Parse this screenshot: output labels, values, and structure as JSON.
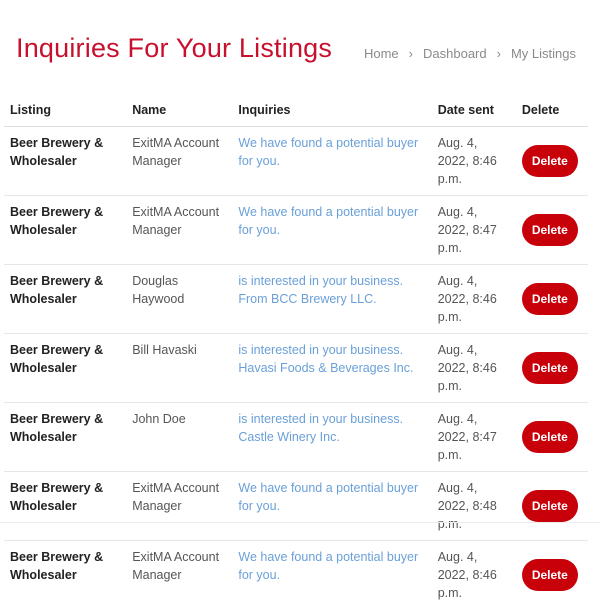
{
  "page": {
    "title": "Inquiries For Your Listings"
  },
  "breadcrumb": {
    "items": [
      "Home",
      "Dashboard",
      "My Listings"
    ],
    "separator": "›"
  },
  "table": {
    "headers": {
      "listing": "Listing",
      "name": "Name",
      "inquiries": "Inquiries",
      "date_sent": "Date sent",
      "delete": "Delete"
    },
    "delete_label": "Delete",
    "rows": [
      {
        "listing": "Beer Brewery & Wholesaler",
        "name": "ExitMA Account Manager",
        "inquiry": "We have found a potential buyer for you.",
        "date": "Aug. 4, 2022, 8:46 p.m."
      },
      {
        "listing": "Beer Brewery & Wholesaler",
        "name": "ExitMA Account Manager",
        "inquiry": "We have found a potential buyer for you.",
        "date": "Aug. 4, 2022, 8:47 p.m."
      },
      {
        "listing": "Beer Brewery & Wholesaler",
        "name": "Douglas Haywood",
        "inquiry": "is interested in your business. From BCC Brewery LLC.",
        "date": "Aug. 4, 2022, 8:46 p.m."
      },
      {
        "listing": "Beer Brewery & Wholesaler",
        "name": "Bill Havaski",
        "inquiry": "is interested in your business. Havasi Foods & Beverages Inc.",
        "date": "Aug. 4, 2022, 8:46 p.m."
      },
      {
        "listing": "Beer Brewery & Wholesaler",
        "name": "John Doe",
        "inquiry": "is interested in your business. Castle Winery Inc.",
        "date": "Aug. 4, 2022, 8:47 p.m."
      },
      {
        "listing": "Beer Brewery & Wholesaler",
        "name": "ExitMA Account Manager",
        "inquiry": "We have found a potential buyer for you.",
        "date": "Aug. 4, 2022, 8:48 p.m."
      },
      {
        "listing": "Beer Brewery & Wholesaler",
        "name": "ExitMA Account Manager",
        "inquiry": "We have found a potential buyer for you.",
        "date": "Aug. 4, 2022, 8:46 p.m."
      }
    ]
  },
  "colors": {
    "title": "#c8102e",
    "delete_button": "#c8000a",
    "inquiry_link": "#6aa0d8"
  }
}
